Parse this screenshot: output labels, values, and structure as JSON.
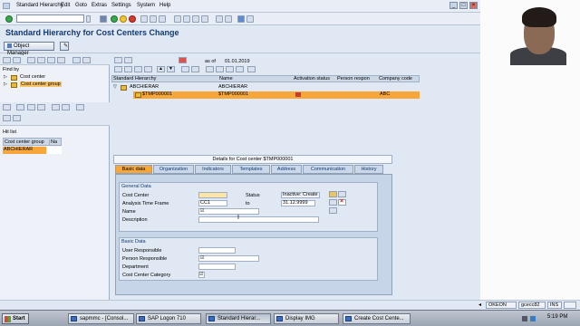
{
  "menu": [
    "Standard Hierarchy",
    "Edit",
    "Goto",
    "Extras",
    "Settings",
    "System",
    "Help"
  ],
  "title": "Standard Hierarchy for Cost Centers Change",
  "app_toolbar": {
    "object_manager": "Object Manager"
  },
  "left_pane": {
    "find_by_label": "Find by",
    "tree_items": [
      "Cost center",
      "Cost center group"
    ],
    "hit_list_label": "Hit list",
    "hit_list_headers": [
      "Cost center group",
      "Na"
    ],
    "hit_list_rows": [
      [
        "ABCHIERAR",
        ""
      ]
    ]
  },
  "right_pane": {
    "as_of_label": "as of",
    "as_of_value": "01.01.2019",
    "tree_headers": [
      "Standard Hierarchy",
      "Name",
      "Activation status",
      "Person respon",
      "Company code"
    ],
    "tree_rows": [
      {
        "node": "ABCHIERAR",
        "name": "ABCHIERAR",
        "status": "",
        "person": "",
        "company": ""
      },
      {
        "node": "$TMP000001",
        "name": "$TMP000001",
        "status": "",
        "person": "",
        "company": "ABC"
      }
    ]
  },
  "detail": {
    "title": "Details for Cost center $TMP000001",
    "tabs": [
      "Basic data",
      "Organization",
      "Indicators",
      "Templates",
      "Address",
      "Communication",
      "History"
    ],
    "general": {
      "title": "General Data",
      "cost_center_label": "Cost Center",
      "cost_center_value": "",
      "status_label": "Status",
      "status_value": "Inactive: Create",
      "time_frame_label": "Analysis Time Frame",
      "from_value": "CC1",
      "to_label": "to",
      "to_value": "31.12.9999",
      "name_label": "Name",
      "name_value": "",
      "description_label": "Description",
      "description_value": ""
    },
    "basic": {
      "title": "Basic Data",
      "user_responsible_label": "User Responsible",
      "person_responsible_label": "Person Responsible",
      "department_label": "Department",
      "category_label": "Cost Center Category"
    }
  },
  "statusbar": {
    "system": "OKEON",
    "server": "gcecc82",
    "mode": "INS"
  },
  "taskbar": {
    "start": "Start",
    "tasks": [
      "sapmmc - [Consol...",
      "SAP Logon 710",
      "Standard Hierar...",
      "Display IMG",
      "Create Cost Cente..."
    ],
    "clock": "5:19 PM"
  }
}
